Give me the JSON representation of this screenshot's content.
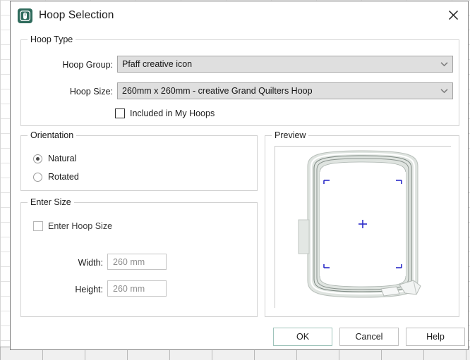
{
  "window": {
    "title": "Hoop Selection",
    "icon": "hoop-app-icon",
    "close_icon": "close-icon"
  },
  "hoop_type": {
    "legend": "Hoop Type",
    "group_label": "Hoop Group:",
    "group_value": "Pfaff creative icon",
    "size_label": "Hoop Size:",
    "size_value": "260mm x 260mm - creative Grand Quilters Hoop",
    "dropdown_icon": "chevron-down-icon",
    "included_label": "Included in My Hoops",
    "included_checked": false
  },
  "orientation": {
    "legend": "Orientation",
    "options": [
      {
        "label": "Natural",
        "selected": true
      },
      {
        "label": "Rotated",
        "selected": false
      }
    ]
  },
  "enter_size": {
    "legend": "Enter Size",
    "enable_label": "Enter Hoop Size",
    "enable_checked": false,
    "width_label": "Width:",
    "width_value": "260 mm",
    "height_label": "Height:",
    "height_value": "260 mm"
  },
  "preview": {
    "legend": "Preview",
    "hoop_fill": "#dfe4e0",
    "hoop_stroke": "#6f7873",
    "marker_color": "#2b2bc8"
  },
  "buttons": {
    "ok": "OK",
    "cancel": "Cancel",
    "help": "Help"
  }
}
